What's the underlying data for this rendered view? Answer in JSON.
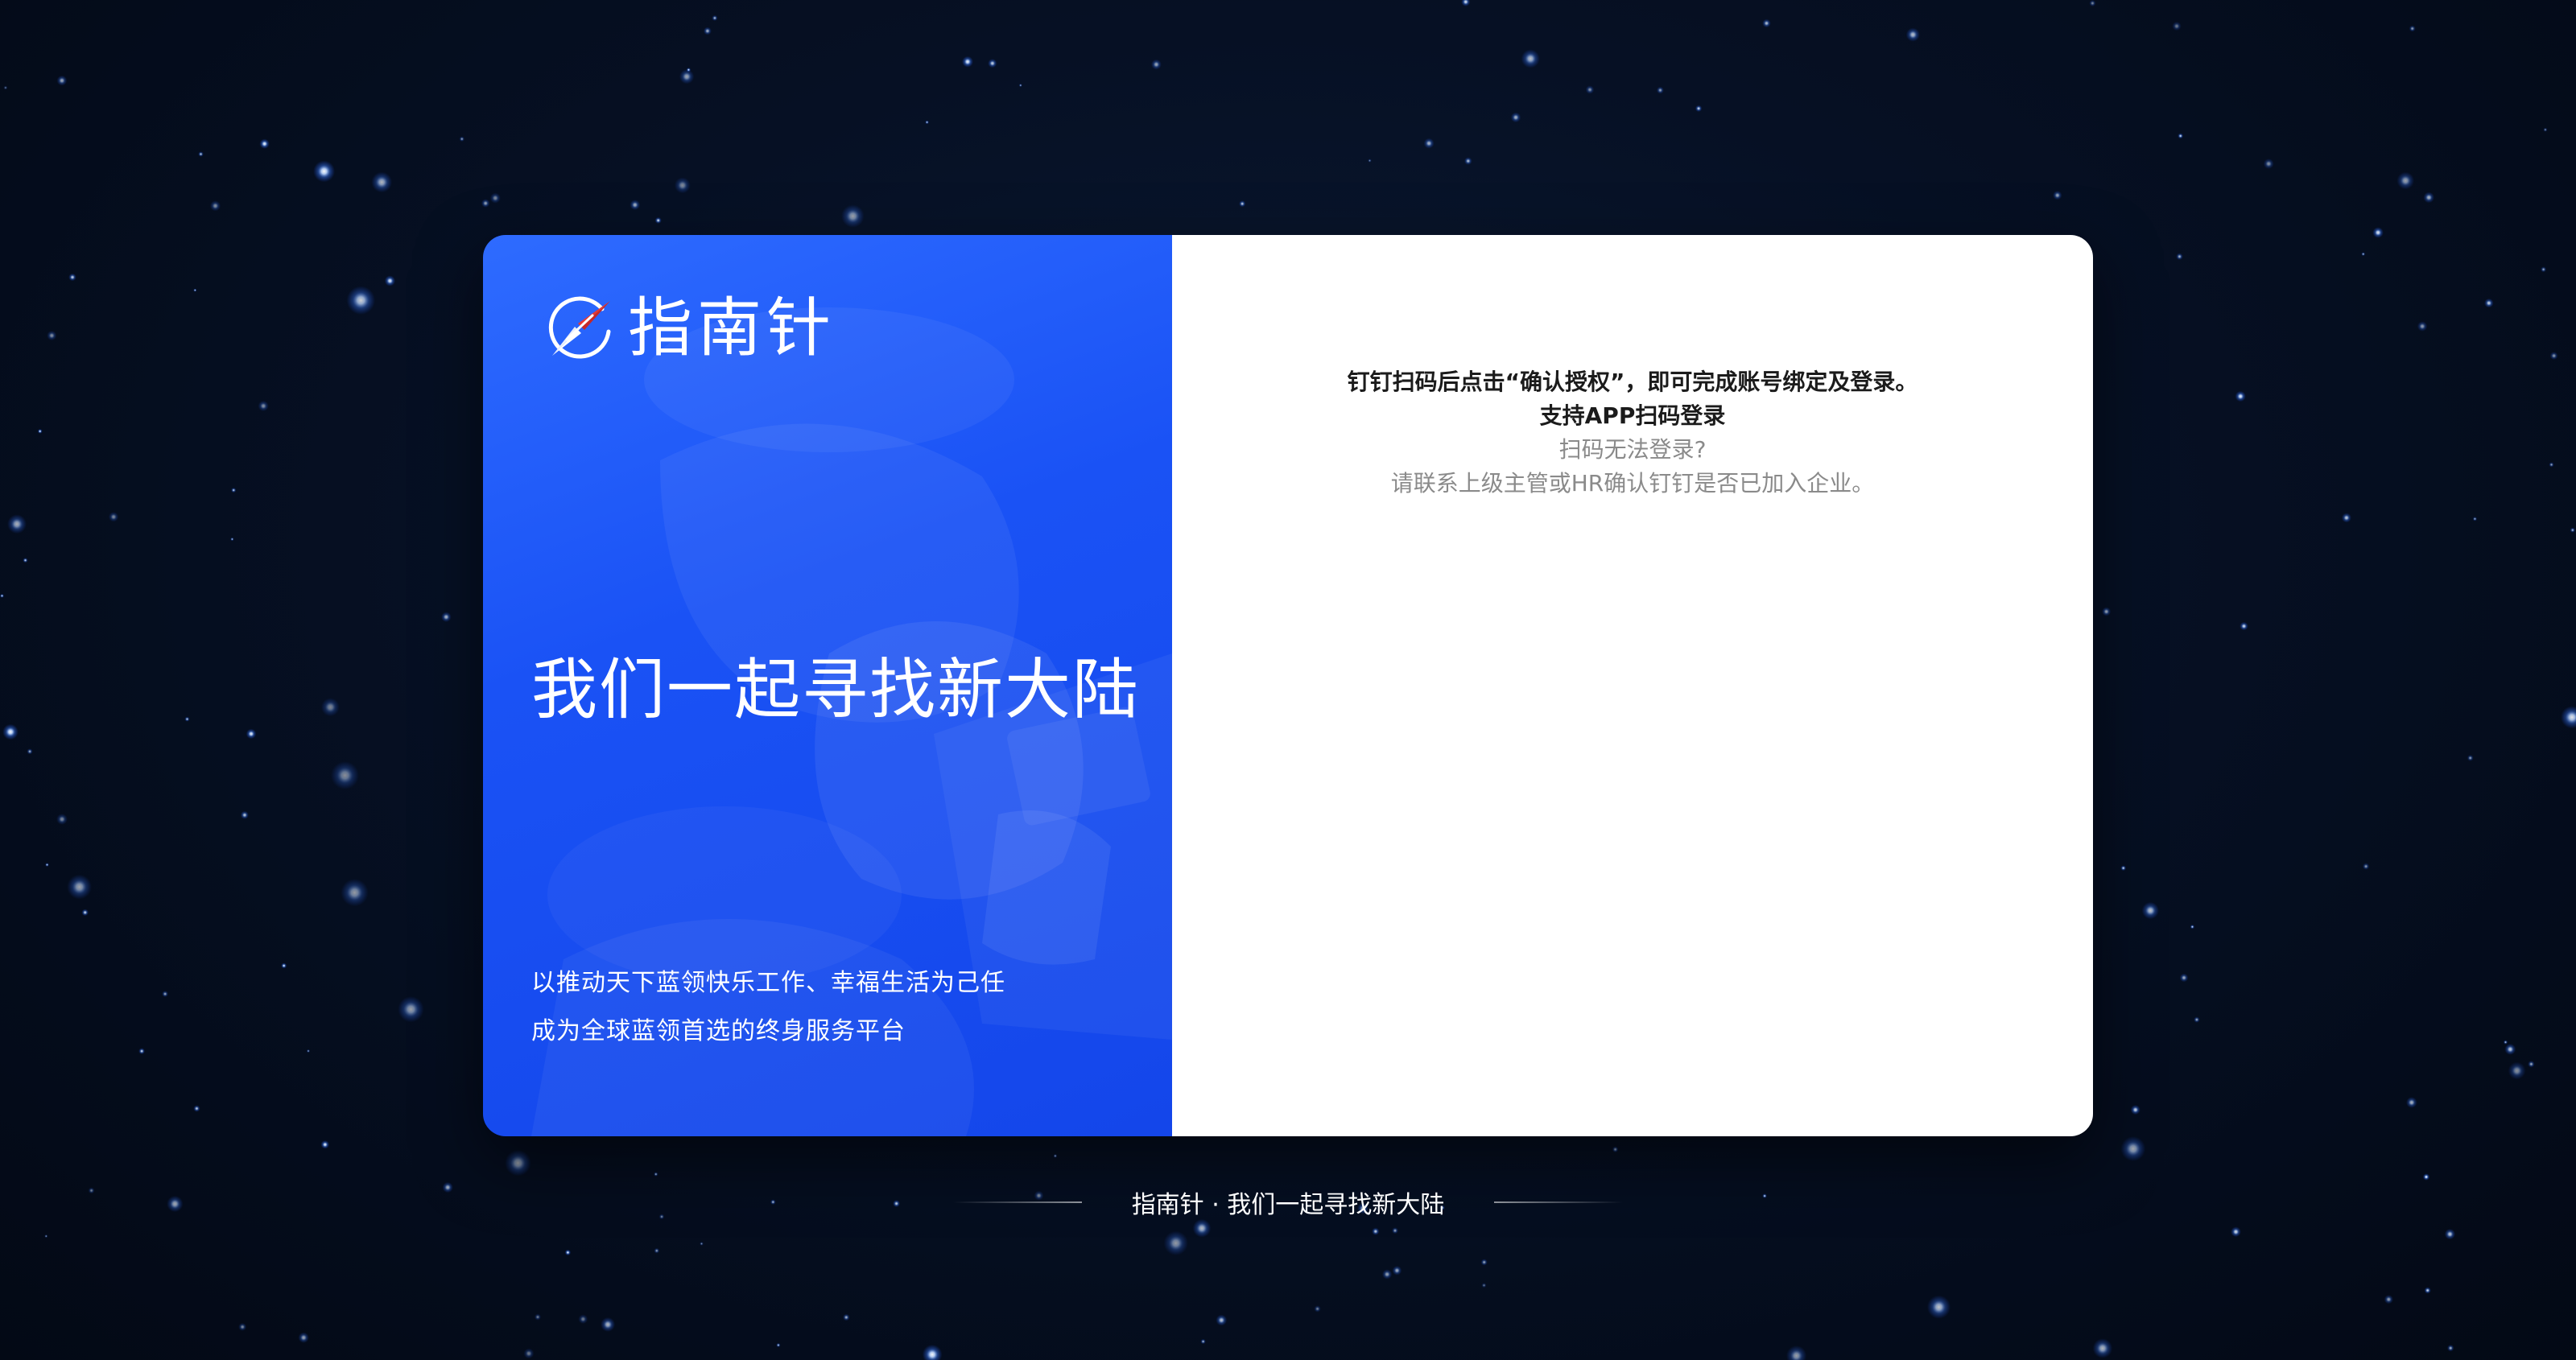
{
  "brand": {
    "name": "指南针",
    "logo_icon": "compass-icon"
  },
  "hero": {
    "slogan": "我们一起寻找新大陆",
    "mission_line1": "以推动天下蓝领快乐工作、幸福生活为己任",
    "mission_line2": "成为全球蓝领首选的终身服务平台"
  },
  "login": {
    "instruction": "钉钉扫码后点击“确认授权”，即可完成账号绑定及登录。",
    "app_support": "支持APP扫码登录",
    "help_question": "扫码无法登录?",
    "help_answer": "请联系上级主管或HR确认钉钉是否已加入企业。"
  },
  "footer": {
    "text": "指南针 · 我们一起寻找新大陆"
  },
  "colors": {
    "accent": "#1a52f5",
    "background": "#061024"
  }
}
